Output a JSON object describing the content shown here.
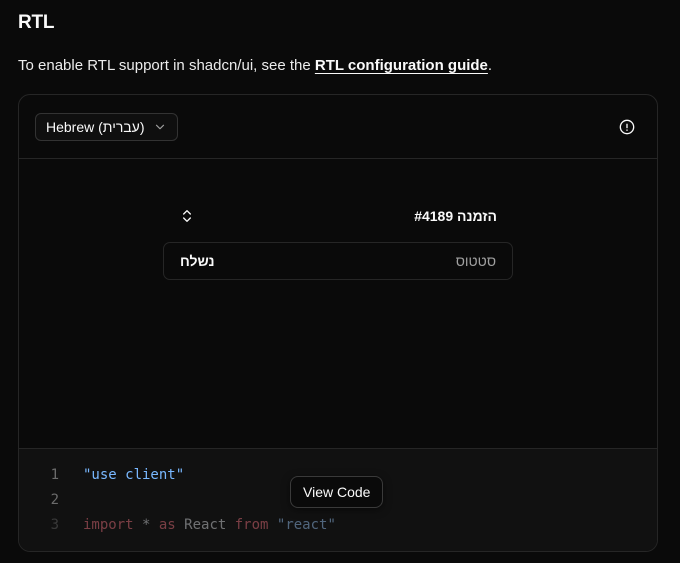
{
  "heading": "RTL",
  "intro": {
    "prefix": "To enable RTL support in shadcn/ui, see the ",
    "link_label": "RTL configuration guide",
    "suffix": "."
  },
  "toolbar": {
    "language_select_value": "Hebrew (עברית)",
    "language_select_icon": "chevron-down-icon",
    "info_icon": "info-circle-icon"
  },
  "demo": {
    "order_title": "הזמנה #4189",
    "toggle_icon": "chevrons-up-down-icon",
    "status_label": "סטטוס",
    "status_value": "נשלח"
  },
  "code": {
    "lines": [
      {
        "no": "1",
        "text": "\"use client\""
      },
      {
        "no": "2",
        "text": ""
      },
      {
        "no": "3",
        "tokens": {
          "kw1": "import",
          "plain1": " * ",
          "kw2": "as",
          "plain2": " React ",
          "kw3": "from",
          "str": " \"react\""
        }
      }
    ],
    "view_code_label": "View Code"
  },
  "colors": {
    "background": "#0a0a0a",
    "border": "#262626",
    "string": "#79b8ff",
    "keyword": "#f97583"
  }
}
